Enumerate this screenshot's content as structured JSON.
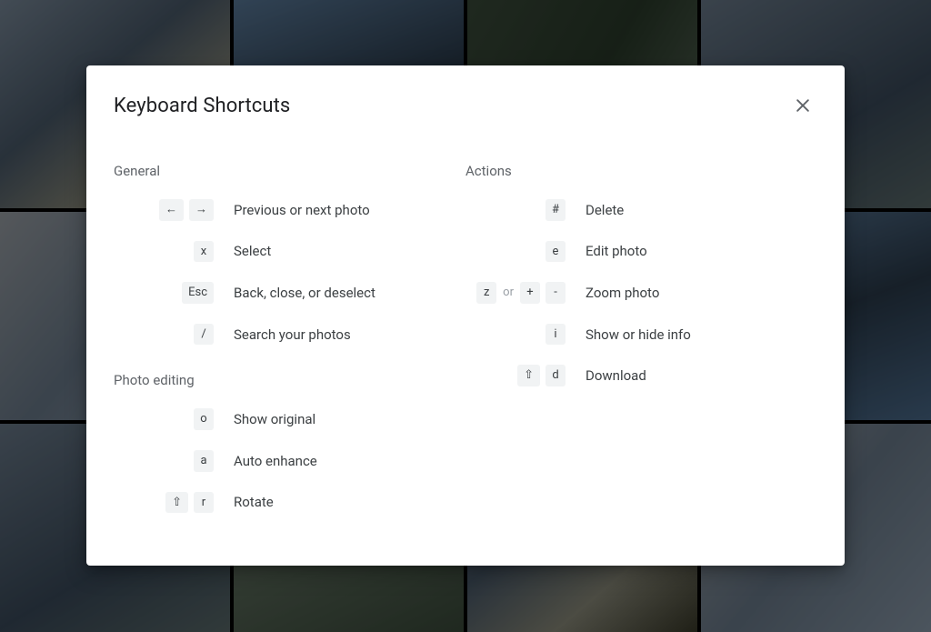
{
  "dialog_title": "Keyboard Shortcuts",
  "sections": {
    "general": {
      "title": "General",
      "shortcuts": [
        {
          "keys": [
            "←",
            "→"
          ],
          "desc": "Previous or next photo"
        },
        {
          "keys": [
            "x"
          ],
          "desc": "Select"
        },
        {
          "keys": [
            "Esc"
          ],
          "desc": "Back, close, or deselect"
        },
        {
          "keys": [
            "/"
          ],
          "desc": "Search your photos"
        }
      ]
    },
    "photo_editing": {
      "title": "Photo editing",
      "shortcuts": [
        {
          "keys": [
            "o"
          ],
          "desc": "Show original"
        },
        {
          "keys": [
            "a"
          ],
          "desc": "Auto enhance"
        },
        {
          "keys": [
            "⇧",
            "r"
          ],
          "desc": "Rotate"
        }
      ]
    },
    "actions": {
      "title": "Actions",
      "shortcuts": [
        {
          "keys": [
            "#"
          ],
          "desc": "Delete"
        },
        {
          "keys": [
            "e"
          ],
          "desc": "Edit photo"
        },
        {
          "keys": [
            "z",
            {
              "sep": "or"
            },
            "+",
            "-"
          ],
          "desc": "Zoom photo"
        },
        {
          "keys": [
            "i"
          ],
          "desc": "Show or hide info"
        },
        {
          "keys": [
            "⇧",
            "d"
          ],
          "desc": "Download"
        }
      ]
    }
  }
}
